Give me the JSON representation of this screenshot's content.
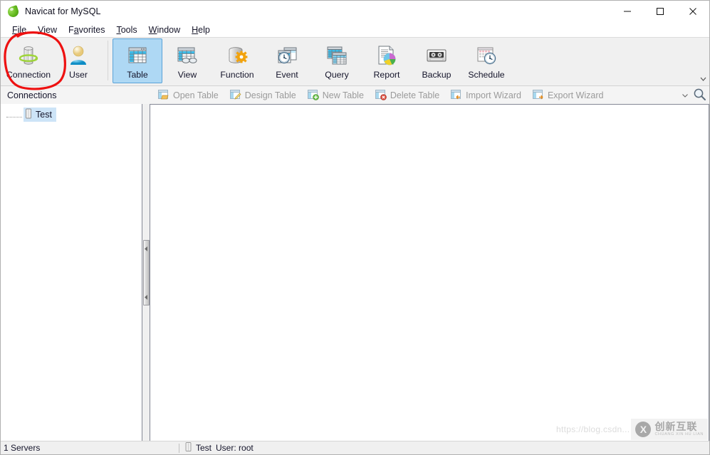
{
  "window": {
    "title": "Navicat for MySQL",
    "app_icon": "navicat-leaf-icon",
    "controls": {
      "minimize": "minimize-icon",
      "maximize": "maximize-icon",
      "close": "close-icon"
    }
  },
  "menubar": {
    "items": [
      {
        "name": "file",
        "label": "File",
        "accel": "F"
      },
      {
        "name": "view",
        "label": "View",
        "accel": "V"
      },
      {
        "name": "favorites",
        "label": "Favorites",
        "accel": "a"
      },
      {
        "name": "tools",
        "label": "Tools",
        "accel": "T"
      },
      {
        "name": "window",
        "label": "Window",
        "accel": "W"
      },
      {
        "name": "help",
        "label": "Help",
        "accel": "H"
      }
    ]
  },
  "main_toolbar": {
    "buttons": [
      {
        "name": "connection",
        "label": "Connection",
        "icon": "connection-icon",
        "selected": false,
        "annotated": true
      },
      {
        "name": "user",
        "label": "User",
        "icon": "user-icon",
        "selected": false
      },
      {
        "name": "table",
        "label": "Table",
        "icon": "table-icon",
        "selected": true
      },
      {
        "name": "view",
        "label": "View",
        "icon": "view-icon",
        "selected": false
      },
      {
        "name": "function",
        "label": "Function",
        "icon": "function-icon",
        "selected": false
      },
      {
        "name": "event",
        "label": "Event",
        "icon": "event-icon",
        "selected": false
      },
      {
        "name": "query",
        "label": "Query",
        "icon": "query-icon",
        "selected": false
      },
      {
        "name": "report",
        "label": "Report",
        "icon": "report-icon",
        "selected": false
      },
      {
        "name": "backup",
        "label": "Backup",
        "icon": "backup-icon",
        "selected": false
      },
      {
        "name": "schedule",
        "label": "Schedule",
        "icon": "schedule-icon",
        "selected": false
      }
    ],
    "overflow_icon": "chevron-down-icon"
  },
  "sub_toolbar": {
    "connections_label": "Connections",
    "buttons": [
      {
        "name": "open-table",
        "label": "Open Table",
        "icon": "open-table-icon"
      },
      {
        "name": "design-table",
        "label": "Design Table",
        "icon": "design-table-icon"
      },
      {
        "name": "new-table",
        "label": "New Table",
        "icon": "new-table-icon"
      },
      {
        "name": "delete-table",
        "label": "Delete Table",
        "icon": "delete-table-icon"
      },
      {
        "name": "import-wizard",
        "label": "Import Wizard",
        "icon": "import-wizard-icon"
      },
      {
        "name": "export-wizard",
        "label": "Export Wizard",
        "icon": "export-wizard-icon"
      }
    ],
    "overflow_icon": "chevron-down-icon",
    "search_icon": "search-icon"
  },
  "sidebar": {
    "tree": [
      {
        "name": "connection-test",
        "label": "Test",
        "icon": "database-server-icon",
        "selected": true
      }
    ]
  },
  "statusbar": {
    "servers": "1 Servers",
    "connection_icon": "database-server-icon",
    "connection": "Test",
    "user": "User: root"
  },
  "watermark": {
    "url": "https://blog.csdn...",
    "logo_mark": "X",
    "brand_cn": "创新互联",
    "brand_pinyin": "CHUANG XIN HU LIAN"
  },
  "colors": {
    "selection_blue": "#aed8f4",
    "selection_border": "#5ba3d8",
    "tree_selection": "#cde4f7",
    "toolbar_bg": "#f0f0f0",
    "annotation_red": "#ee1111",
    "disabled_text": "#9a9a9a"
  }
}
